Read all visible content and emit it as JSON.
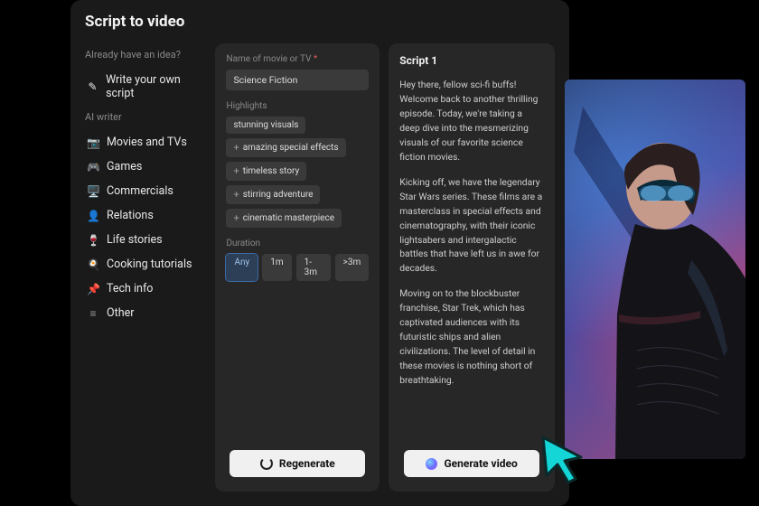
{
  "title": "Script to video",
  "sidebar": {
    "idea_head": "Already have an idea?",
    "write_own": "Write your own script",
    "ai_head": "AI writer",
    "items": [
      {
        "icon": "📷",
        "label": "Movies and TVs"
      },
      {
        "icon": "🎮",
        "label": "Games"
      },
      {
        "icon": "🖥️",
        "label": "Commercials"
      },
      {
        "icon": "👤",
        "label": "Relations"
      },
      {
        "icon": "🍷",
        "label": "Life stories"
      },
      {
        "icon": "🍳",
        "label": "Cooking tutorials"
      },
      {
        "icon": "📌",
        "label": "Tech info"
      },
      {
        "icon": "≡",
        "label": "Other"
      }
    ]
  },
  "form": {
    "name_label": "Name of movie or TV",
    "name_value": "Science Fiction",
    "highlights_label": "Highlights",
    "tag_first": "stunning visuals",
    "tags": [
      "amazing special effects",
      "timeless story",
      "stirring adventure",
      "cinematic masterpiece"
    ],
    "duration_label": "Duration",
    "durations": [
      "Any",
      "1m",
      "1-3m",
      ">3m"
    ],
    "duration_active": "Any",
    "regenerate": "Regenerate"
  },
  "script": {
    "head": "Script 1",
    "p1": "Hey there, fellow sci-fi buffs! Welcome back to another thrilling episode. Today, we're taking a deep dive into the mesmerizing visuals of our favorite science fiction movies.",
    "p2": "Kicking off, we have the legendary Star Wars series. These films are a masterclass in special effects and cinematography, with their iconic lightsabers and intergalactic battles that have left us in awe for decades.",
    "p3": "Moving on to the blockbuster franchise, Star Trek, which has captivated audiences with its futuristic ships and alien civilizations. The level of detail in these movies is nothing short of breathtaking.",
    "generate": "Generate video"
  },
  "colors": {
    "accent_blue": "#3d6aa5",
    "photo_blue": "#5aa0ff",
    "photo_pink": "#d05a8a"
  }
}
